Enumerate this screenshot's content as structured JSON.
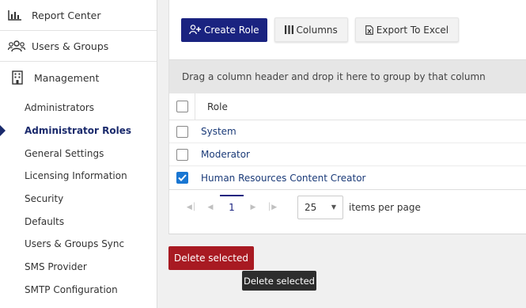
{
  "sidebar": {
    "top_items": [
      {
        "label": "Report Center",
        "icon": "chart-icon"
      },
      {
        "label": "Users & Groups",
        "icon": "users-icon"
      }
    ],
    "management": {
      "label": "Management",
      "icon": "building-icon"
    },
    "sub_items": [
      {
        "label": "Administrators",
        "active": false
      },
      {
        "label": "Administrator Roles",
        "active": true
      },
      {
        "label": "General Settings",
        "active": false
      },
      {
        "label": "Licensing Information",
        "active": false
      },
      {
        "label": "Security",
        "active": false
      },
      {
        "label": "Defaults",
        "active": false
      },
      {
        "label": "Users & Groups Sync",
        "active": false
      },
      {
        "label": "SMS Provider",
        "active": false
      },
      {
        "label": "SMTP Configuration",
        "active": false
      }
    ]
  },
  "toolbar": {
    "create_label": "Create Role",
    "columns_label": "Columns",
    "export_label": "Export To Excel"
  },
  "grid": {
    "group_hint": "Drag a column header and drop it here to group by that column",
    "column_role": "Role",
    "rows": [
      {
        "role": "System",
        "checked": false
      },
      {
        "role": "Moderator",
        "checked": false
      },
      {
        "role": "Human Resources Content Creator",
        "checked": true
      }
    ]
  },
  "pager": {
    "current_page": "1",
    "page_size": "25",
    "items_per_page_label": "items per page"
  },
  "actions": {
    "delete_label": "Delete selected",
    "tooltip": "Delete selected"
  },
  "colors": {
    "primary": "#1a2380",
    "danger": "#a81a22",
    "checkbox_checked": "#1976d2"
  }
}
